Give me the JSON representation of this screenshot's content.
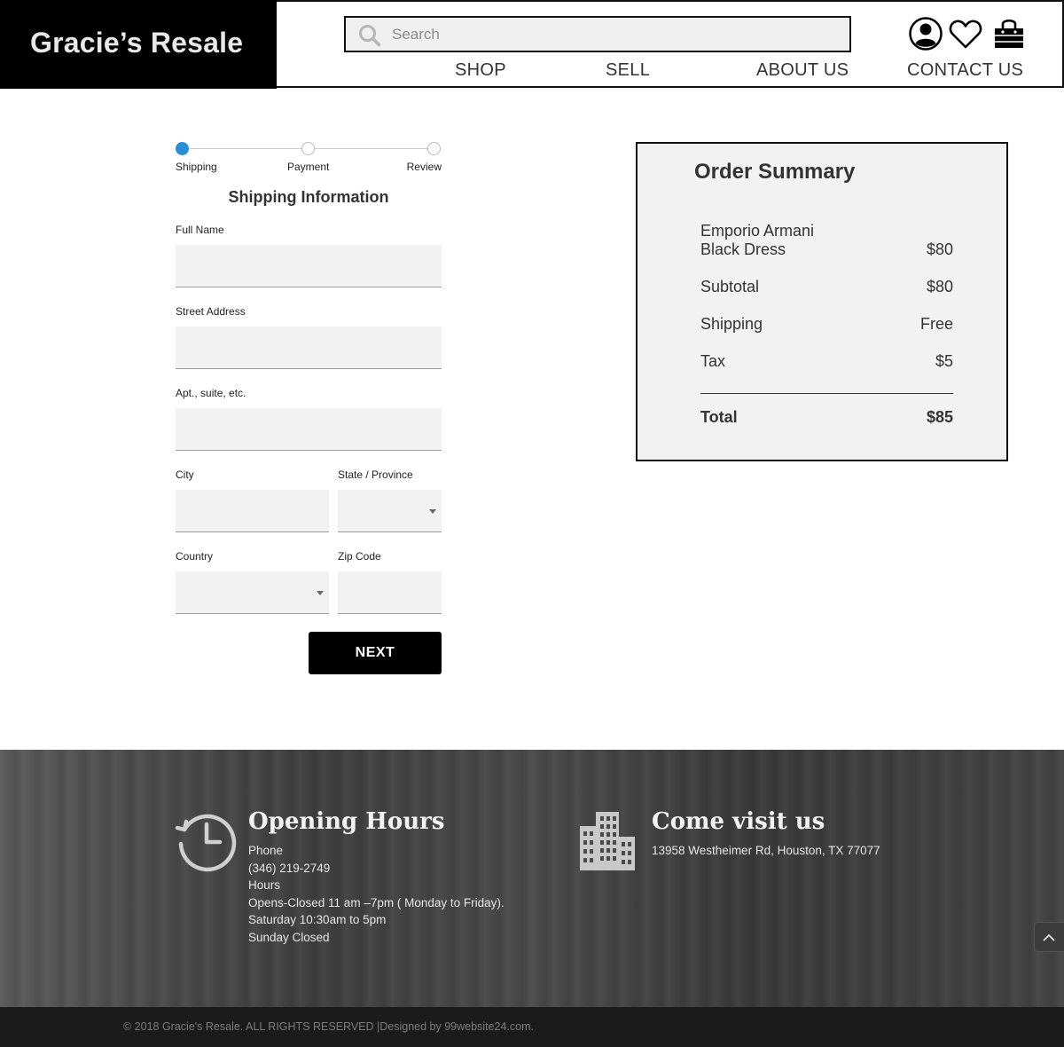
{
  "brand": {
    "name": "Gracie’s Resale"
  },
  "search": {
    "placeholder": "Search"
  },
  "header_icons": [
    "account-icon",
    "heart-icon",
    "shopping-bag-icon"
  ],
  "nav": {
    "shop": "SHOP",
    "sell": "SELL",
    "about": "ABOUT US",
    "contact": "CONTACT US"
  },
  "checkout": {
    "steps": [
      "Shipping",
      "Payment",
      "Review"
    ],
    "active_step": "Shipping",
    "title": "Shipping Information",
    "fields": {
      "full_name": "Full Name",
      "street": "Street Address",
      "apt": "Apt., suite, etc.",
      "city": "City",
      "state": "State / Province",
      "country": "Country",
      "zip": "Zip Code"
    },
    "next_label": "NEXT"
  },
  "summary": {
    "title": "Order Summary",
    "item_line1": "Emporio Armani",
    "item_line2": "Black Dress",
    "item_price": "$80",
    "subtotal_label": "Subtotal",
    "subtotal_value": "$80",
    "shipping_label": "Shipping",
    "shipping_value": "Free",
    "tax_label": "Tax",
    "tax_value": "$5",
    "total_label": "Total",
    "total_value": "$85"
  },
  "footer": {
    "hours_title": "Opening Hours",
    "phone_label": "Phone",
    "phone": "(346) 219-2749",
    "hours_label": "Hours",
    "hours_weekday": "Opens-Closed  11 am –7pm ( Monday to Friday).",
    "hours_saturday": "Saturday 10:30am to 5pm",
    "hours_sunday": "Sunday Closed",
    "visit_title": "Come visit us",
    "address": "13958 Westheimer Rd, Houston, TX 77077",
    "copyright": "© 2018 Gracie's Resale. ALL RIGHTS RESERVED |Designed by 99website24.com."
  },
  "colors": {
    "accent": "#2a8fd6",
    "header_bg": "#000000",
    "footer_bar": "#1b1b1b"
  }
}
